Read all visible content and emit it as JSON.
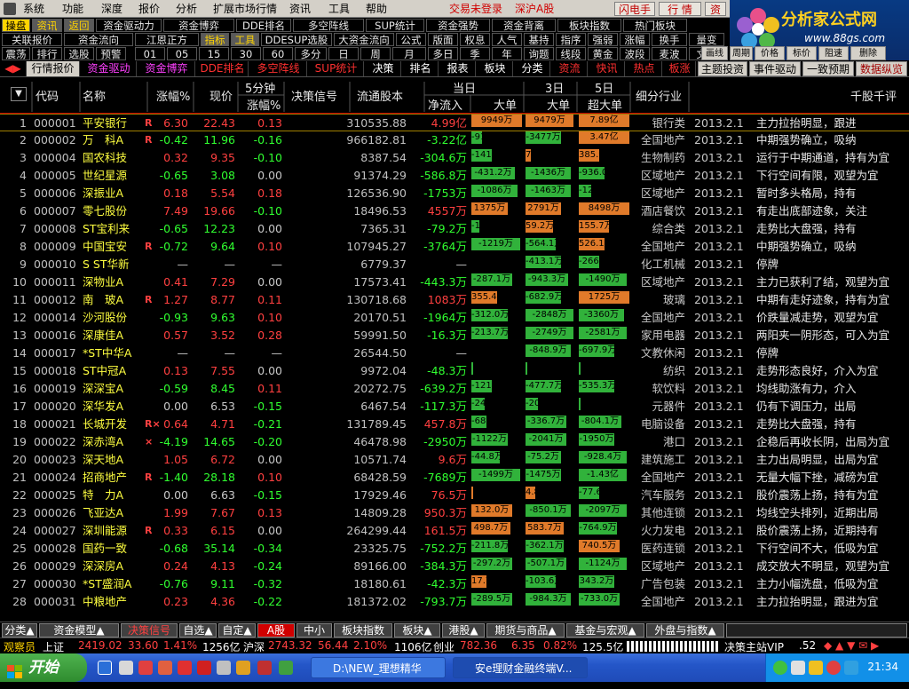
{
  "menubar": {
    "items": [
      "系统",
      "功能",
      "深度",
      "报价",
      "分析",
      "扩展市场行情",
      "资讯",
      "工具",
      "帮助"
    ],
    "status_login": "交易未登录",
    "market": "深沪A股",
    "btn_flash": "闪电手",
    "btn_quote": "行 情",
    "btn_info": "资"
  },
  "logo": {
    "title": "分析家公式网",
    "url": "www.88gs.com"
  },
  "toolbar": {
    "row1": [
      "操盘",
      "资讯",
      "返回",
      "资金驱动力",
      "资金博弈",
      "DDE排名",
      "多空阵线",
      "SUP统计",
      "资金强势",
      "资金背离",
      "板块指数",
      "热门板块"
    ],
    "row2": [
      "关联报价",
      "资金流向",
      "江恩正方",
      "指标",
      "工具",
      "DDESUP选股",
      "大资金流向",
      "公式",
      "版面",
      "权息",
      "人气",
      "基持",
      "指序",
      "强弱",
      "涨幅",
      "换手",
      "量变"
    ],
    "row3": [
      "震荡",
      "排行",
      "选股",
      "预警",
      "01",
      "05",
      "15",
      "30",
      "60",
      "多分",
      "日",
      "周",
      "月",
      "多日",
      "季",
      "年",
      "询题",
      "线段",
      "黄金",
      "波段",
      "麦波",
      "文字"
    ],
    "right_small": [
      "画线",
      "删除",
      "周期",
      "价格",
      "标价",
      "阻速",
      "删除"
    ]
  },
  "tabs": [
    "行情报价",
    "资金驱动",
    "资金博弈",
    "DDE排名",
    "多空阵线",
    "SUP统计",
    "决策",
    "排名",
    "报表",
    "板块",
    "分类",
    "资流",
    "快讯",
    "热点",
    "板涨",
    "主题投资",
    "事件驱动",
    "一致预期",
    "数据纵览"
  ],
  "headers": {
    "code": "代码",
    "name": "名称",
    "pct": "涨幅%",
    "price": "现价",
    "speed_top": "5分钟",
    "speed_bot": "涨幅%",
    "signal": "决策信号",
    "cap": "流通股本",
    "today": "当日",
    "net_in": "净流入",
    "big1": "大单",
    "d3": "3日",
    "big3": "大单",
    "d5": "5日",
    "sbig5": "超大单",
    "industry": "细分行业",
    "comment": "千股千评"
  },
  "rows": [
    {
      "i": "1",
      "code": "000001",
      "name": "平安银行",
      "r": "R",
      "pct": "6.30",
      "price": "22.43",
      "spd": "0.13",
      "sig": [
        "dot",
        "dot"
      ],
      "cap": "310535.88",
      "flow": "4.99亿",
      "f1": "9949万",
      "f1v": 99,
      "f3": "9479万",
      "f3v": 95,
      "f5": "7.89亿",
      "f5v": 100,
      "ind": "银行类",
      "date": "2013.2.1",
      "cmt": "主力拉抬明显，跟进"
    },
    {
      "i": "2",
      "code": "000002",
      "name": "万　科A",
      "r": "R",
      "pct": "-0.42",
      "price": "11.96",
      "spd": "-0.16",
      "sig": [
        "tdn",
        "dot"
      ],
      "cap": "966182.81",
      "flow": "-3.22亿",
      "f1": "-915.2万",
      "f1v": -20,
      "f3": "-3477万",
      "f3v": -70,
      "f5": "3.47亿",
      "f5v": 100,
      "ind": "全国地产",
      "date": "2013.2.1",
      "cmt": "中期强势确立，吸纳"
    },
    {
      "i": "3",
      "code": "000004",
      "name": "国农科技",
      "r": "",
      "pct": "0.32",
      "price": "9.35",
      "spd": "-0.10",
      "sig": [
        "dot",
        "dot"
      ],
      "cap": "8387.54",
      "flow": "-304.6万",
      "f1": "-141.3万",
      "f1v": -40,
      "f3": "7.7万",
      "f3v": 10,
      "f5": "385.9万",
      "f5v": 40,
      "ind": "生物制药",
      "date": "2013.2.1",
      "cmt": "运行于中期通道，持有为宜"
    },
    {
      "i": "4",
      "code": "000005",
      "name": "世纪星源",
      "r": "",
      "pct": "-0.65",
      "price": "3.08",
      "spd": "0.00",
      "sig": [
        "tdn",
        "dot"
      ],
      "cap": "91374.29",
      "flow": "-586.8万",
      "f1": "-431.2万",
      "f1v": -85,
      "f3": "-1436万",
      "f3v": -90,
      "f5": "-936.0万",
      "f5v": -50,
      "ind": "区域地产",
      "date": "2013.2.1",
      "cmt": "下行空间有限，观望为宜"
    },
    {
      "i": "5",
      "code": "000006",
      "name": "深振业A",
      "r": "",
      "pct": "0.18",
      "price": "5.54",
      "spd": "0.18",
      "sig": [
        "dot",
        "dot"
      ],
      "cap": "126536.90",
      "flow": "-1753万",
      "f1": "-1086万",
      "f1v": -90,
      "f3": "-1463万",
      "f3v": -90,
      "f5": "-123.5万",
      "f5v": -25,
      "ind": "区域地产",
      "date": "2013.2.1",
      "cmt": "暂时多头格局，持有"
    },
    {
      "i": "6",
      "code": "000007",
      "name": "零七股份",
      "r": "",
      "pct": "7.49",
      "price": "19.66",
      "spd": "-0.10",
      "sig": [
        "dot",
        "dot"
      ],
      "cap": "18496.53",
      "flow": "4557万",
      "f1": "1375万",
      "f1v": 70,
      "f3": "2791万",
      "f3v": 70,
      "f5": "8498万",
      "f5v": 100,
      "ind": "酒店餐饮",
      "date": "2013.2.1",
      "cmt": "有走出底部迹象，关注"
    },
    {
      "i": "7",
      "code": "000008",
      "name": "ST宝利来",
      "r": "",
      "pct": "-0.65",
      "price": "12.23",
      "spd": "0.00",
      "sig": [
        "dot",
        "dot"
      ],
      "cap": "7365.31",
      "flow": "-79.2万",
      "f1": "-11.8万",
      "f1v": -15,
      "f3": "59.2万",
      "f3v": 55,
      "f5": "155.7万",
      "f5v": 60,
      "ind": "综合类",
      "date": "2013.2.1",
      "cmt": "走势比大盘强，持有"
    },
    {
      "i": "8",
      "code": "000009",
      "name": "中国宝安",
      "r": "R",
      "pct": "-0.72",
      "price": "9.64",
      "spd": "0.10",
      "sig": [
        "dot",
        "dot"
      ],
      "cap": "107945.27",
      "flow": "-3764万",
      "f1": "-1219万",
      "f1v": -95,
      "f3": "-564.1万",
      "f3v": -60,
      "f5": "526.1万",
      "f5v": 50,
      "ind": "全国地产",
      "date": "2013.2.1",
      "cmt": "中期强势确立，吸纳"
    },
    {
      "i": "9",
      "code": "000010",
      "name": "S ST华新",
      "r": "",
      "pct": "—",
      "price": "—",
      "spd": "—",
      "sig": [],
      "cap": "6779.37",
      "flow": "—",
      "f1": "",
      "f1v": 0,
      "f3": "-413.1万",
      "f3v": -70,
      "f5": "-266.9万",
      "f5v": -40,
      "ind": "化工机械",
      "date": "2013.2.1",
      "cmt": "停牌"
    },
    {
      "i": "10",
      "code": "000011",
      "name": "深物业A",
      "r": "",
      "pct": "0.41",
      "price": "7.29",
      "spd": "0.00",
      "sig": [
        "sq",
        "dot"
      ],
      "cap": "17573.41",
      "flow": "-443.3万",
      "f1": "-287.1万",
      "f1v": -80,
      "f3": "-943.3万",
      "f3v": -85,
      "f5": "-1490万",
      "f5v": -95,
      "ind": "区域地产",
      "date": "2013.2.1",
      "cmt": "主力已获利了结，观望为宜"
    },
    {
      "i": "11",
      "code": "000012",
      "name": "南　玻A",
      "r": "R",
      "pct": "1.27",
      "price": "8.77",
      "spd": "0.11",
      "sig": [
        "dot",
        "dot"
      ],
      "cap": "130718.68",
      "flow": "1083万",
      "f1": "355.4万",
      "f1v": 50,
      "f3": "-682.9万",
      "f3v": -70,
      "f5": "1725万",
      "f5v": 100,
      "ind": "玻璃",
      "date": "2013.2.1",
      "cmt": "中期有走好迹象，持有为宜"
    },
    {
      "i": "12",
      "code": "000014",
      "name": "沙河股份",
      "r": "",
      "pct": "-0.93",
      "price": "9.63",
      "spd": "0.10",
      "sig": [
        "sq",
        "dot"
      ],
      "cap": "20170.51",
      "flow": "-1964万",
      "f1": "-312.0万",
      "f1v": -70,
      "f3": "-2848万",
      "f3v": -95,
      "f5": "-3360万",
      "f5v": -90,
      "ind": "全国地产",
      "date": "2013.2.1",
      "cmt": "价跌量减走势，观望为宜"
    },
    {
      "i": "13",
      "code": "000016",
      "name": "深康佳A",
      "r": "",
      "pct": "0.57",
      "price": "3.52",
      "spd": "0.28",
      "sig": [
        "dot",
        "dot"
      ],
      "cap": "59991.50",
      "flow": "-16.3万",
      "f1": "-213.7万",
      "f1v": -70,
      "f3": "-2749万",
      "f3v": -95,
      "f5": "-2581万",
      "f5v": -95,
      "ind": "家用电器",
      "date": "2013.2.1",
      "cmt": "两阳夹一阴形态，可入为宜"
    },
    {
      "i": "14",
      "code": "000017",
      "name": "*ST中华A",
      "r": "",
      "pct": "—",
      "price": "—",
      "spd": "—",
      "sig": [],
      "cap": "26544.50",
      "flow": "—",
      "f1": "",
      "f1v": 0,
      "f3": "-848.9万",
      "f3v": -90,
      "f5": "-697.9万",
      "f5v": -70,
      "ind": "文教休闲",
      "date": "2013.2.1",
      "cmt": "停牌"
    },
    {
      "i": "15",
      "code": "000018",
      "name": "ST中冠A",
      "r": "",
      "pct": "0.13",
      "price": "7.55",
      "spd": "0.00",
      "sig": [
        "dot",
        "dot"
      ],
      "cap": "9972.04",
      "flow": "-48.3万",
      "f1": "",
      "f1v": -2,
      "f3": "",
      "f3v": -2,
      "f5": "",
      "f5v": -2,
      "ind": "纺织",
      "date": "2013.2.1",
      "cmt": "走势形态良好，介入为宜"
    },
    {
      "i": "16",
      "code": "000019",
      "name": "深深宝A",
      "r": "",
      "pct": "-0.59",
      "price": "8.45",
      "spd": "0.11",
      "sig": [
        "tdn",
        "dot"
      ],
      "cap": "20272.75",
      "flow": "-639.2万",
      "f1": "-121.1万",
      "f1v": -40,
      "f3": "-477.7万",
      "f3v": -70,
      "f5": "-535.3万",
      "f5v": -70,
      "ind": "软饮料",
      "date": "2013.2.1",
      "cmt": "均线助涨有力，介入"
    },
    {
      "i": "17",
      "code": "000020",
      "name": "深华发A",
      "r": "",
      "pct": "0.00",
      "price": "6.53",
      "spd": "-0.15",
      "sig": [
        "sq",
        "dot"
      ],
      "cap": "6467.54",
      "flow": "-117.3万",
      "f1": "-24.3万",
      "f1v": -25,
      "f3": "-20.4万",
      "f3v": -25,
      "f5": "",
      "f5v": -2,
      "ind": "元器件",
      "date": "2013.2.1",
      "cmt": "仍有下调压力，出局"
    },
    {
      "i": "18",
      "code": "000021",
      "name": "长城开发",
      "r": "R×",
      "pct": "0.64",
      "price": "4.71",
      "spd": "-0.21",
      "sig": [
        "tup",
        "dot"
      ],
      "cap": "131789.45",
      "flow": "457.8万",
      "f1": "-68.0万",
      "f1v": -30,
      "f3": "-336.7万",
      "f3v": -80,
      "f5": "-804.1万",
      "f5v": -85,
      "ind": "电脑设备",
      "date": "2013.2.1",
      "cmt": "走势比大盘强，持有"
    },
    {
      "i": "19",
      "code": "000022",
      "name": "深赤湾A",
      "r": "×",
      "pct": "-4.19",
      "price": "14.65",
      "spd": "-0.20",
      "sig": [
        "dot",
        "dot"
      ],
      "cap": "46478.98",
      "flow": "-2950万",
      "f1": "-1122万",
      "f1v": -70,
      "f3": "-2041万",
      "f3v": -80,
      "f5": "-1950万",
      "f5v": -70,
      "ind": "港口",
      "date": "2013.2.1",
      "cmt": "企稳后再收长阴，出局为宜"
    },
    {
      "i": "20",
      "code": "000023",
      "name": "深天地A",
      "r": "",
      "pct": "1.05",
      "price": "6.72",
      "spd": "0.00",
      "sig": [
        "dot",
        "dot"
      ],
      "cap": "10571.74",
      "flow": "9.6万",
      "f1": "-44.8万",
      "f1v": -55,
      "f3": "-75.2万",
      "f3v": -70,
      "f5": "-928.4万",
      "f5v": -95,
      "ind": "建筑施工",
      "date": "2013.2.1",
      "cmt": "主力出局明显，出局为宜"
    },
    {
      "i": "21",
      "code": "000024",
      "name": "招商地产",
      "r": "R",
      "pct": "-1.40",
      "price": "28.18",
      "spd": "0.10",
      "sig": [
        "tdn",
        "dot"
      ],
      "cap": "68428.59",
      "flow": "-7689万",
      "f1": "-1499万",
      "f1v": -95,
      "f3": "-1475万",
      "f3v": -70,
      "f5": "-1.43亿",
      "f5v": -95,
      "ind": "全国地产",
      "date": "2013.2.1",
      "cmt": "无量大幅下挫，减磅为宜"
    },
    {
      "i": "22",
      "code": "000025",
      "name": "特　力A",
      "r": "",
      "pct": "0.00",
      "price": "6.63",
      "spd": "-0.15",
      "sig": [
        "dot",
        "dot"
      ],
      "cap": "17929.46",
      "flow": "76.5万",
      "f1": "",
      "f1v": 2,
      "f3": "4.8万",
      "f3v": 20,
      "f5": "-77.6万",
      "f5v": -40,
      "ind": "汽车服务",
      "date": "2013.2.1",
      "cmt": "股价震荡上扬，持有为宜"
    },
    {
      "i": "23",
      "code": "000026",
      "name": "飞亚达A",
      "r": "",
      "pct": "1.99",
      "price": "7.67",
      "spd": "0.13",
      "sig": [
        "sq",
        "tup"
      ],
      "cap": "14809.28",
      "flow": "950.3万",
      "f1": "132.0万",
      "f1v": 80,
      "f3": "-850.1万",
      "f3v": -90,
      "f5": "-2097万",
      "f5v": -95,
      "ind": "其他连锁",
      "date": "2013.2.1",
      "cmt": "均线空头排列，近期出局"
    },
    {
      "i": "24",
      "code": "000027",
      "name": "深圳能源",
      "r": "R",
      "pct": "0.33",
      "price": "6.15",
      "spd": "0.00",
      "sig": [
        "dot",
        "dot"
      ],
      "cap": "264299.44",
      "flow": "161.5万",
      "f1": "498.7万",
      "f1v": 75,
      "f3": "583.7万",
      "f3v": 75,
      "f5": "-764.9万",
      "f5v": -75,
      "ind": "火力发电",
      "date": "2013.2.1",
      "cmt": "股价震荡上扬，近期持有"
    },
    {
      "i": "25",
      "code": "000028",
      "name": "国药一致",
      "r": "",
      "pct": "-0.68",
      "price": "35.14",
      "spd": "-0.34",
      "sig": [
        "tdn",
        "dot"
      ],
      "cap": "23325.75",
      "flow": "-752.2万",
      "f1": "-211.8万",
      "f1v": -70,
      "f3": "-362.1万",
      "f3v": -75,
      "f5": "740.5万",
      "f5v": 80,
      "ind": "医药连锁",
      "date": "2013.2.1",
      "cmt": "下行空间不大，低吸为宜"
    },
    {
      "i": "26",
      "code": "000029",
      "name": "深深房A",
      "r": "",
      "pct": "0.24",
      "price": "4.13",
      "spd": "-0.24",
      "sig": [
        "sq",
        "dot"
      ],
      "cap": "89166.00",
      "flow": "-384.3万",
      "f1": "-297.2万",
      "f1v": -80,
      "f3": "-507.1万",
      "f3v": -80,
      "f5": "-1124万",
      "f5v": -95,
      "ind": "区域地产",
      "date": "2013.2.1",
      "cmt": "成交放大不明显，观望为宜"
    },
    {
      "i": "27",
      "code": "000030",
      "name": "*ST盛润A",
      "r": "",
      "pct": "-0.76",
      "price": "9.11",
      "spd": "-0.32",
      "sig": [
        "dot",
        "dot"
      ],
      "cap": "18180.61",
      "flow": "-42.3万",
      "f1": "17.7万",
      "f1v": 30,
      "f3": "-103.6万",
      "f3v": -60,
      "f5": "343.2万",
      "f5v": -70,
      "ind": "广告包装",
      "date": "2013.2.1",
      "cmt": "主力小幅洗盘，低吸为宜"
    },
    {
      "i": "28",
      "code": "000031",
      "name": "中粮地产",
      "r": "",
      "pct": "0.23",
      "price": "4.36",
      "spd": "-0.22",
      "sig": [
        "sq",
        "dot"
      ],
      "cap": "181372.02",
      "flow": "-793.7万",
      "f1": "-289.5万",
      "f1v": -80,
      "f3": "-984.3万",
      "f3v": -90,
      "f5": "-733.0万",
      "f5v": -80,
      "ind": "全国地产",
      "date": "2013.2.1",
      "cmt": "主力拉抬明显，跟进为宜"
    }
  ],
  "bottom_tabs": [
    "分类▲",
    "资金模型▲",
    "决策信号",
    "自选▲",
    "自定▲",
    "A股",
    "中小",
    "板块指数",
    "板块▲",
    "港股▲",
    "期货与商品▲",
    "基金与宏观▲",
    "外盘与指数▲"
  ],
  "status": {
    "label": "观察员",
    "sh": "上证",
    "sh_val": "2419.02",
    "sh_chg": "33.60",
    "sh_pct": "1.41%",
    "sh_amt": "1256亿",
    "hs": "沪深",
    "hs_val": "2743.32",
    "hs_chg": "56.44",
    "hs_pct": "2.10%",
    "hs_amt": "1106亿",
    "cy": "创业",
    "cy_val": "782.36",
    "cy_chg": "6.35",
    "cy_pct": "0.82%",
    "cy_amt": "125.5亿",
    "server": "决策主站VIP",
    "num": ".52"
  },
  "taskbar": {
    "start": "开始",
    "task1": "D:\\NEW_理想精华",
    "task2": "安e理财金融终端V...",
    "clock": "21:34"
  }
}
